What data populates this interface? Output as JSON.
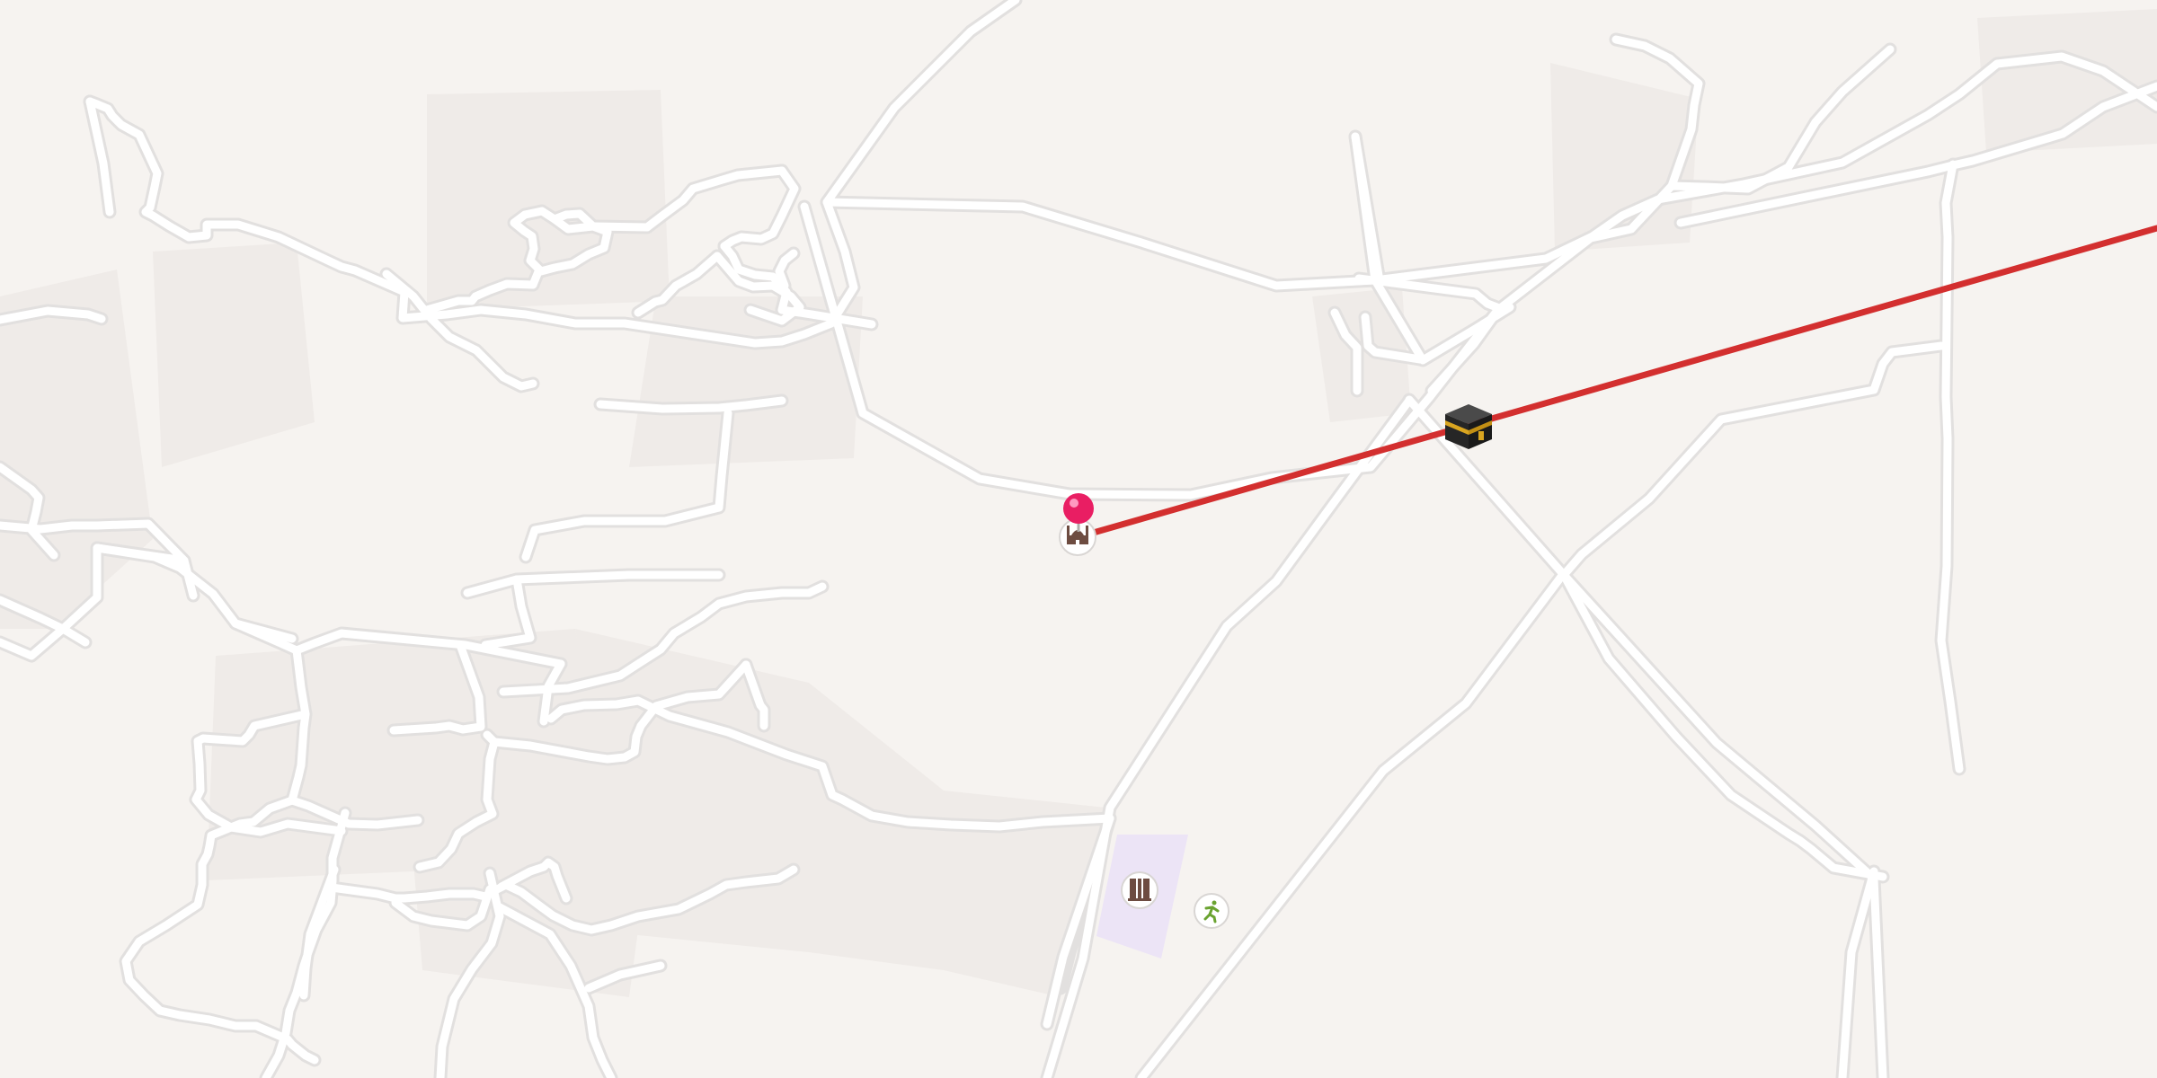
{
  "map": {
    "background_color": "#f6f3f0",
    "road_color": "#ffffff",
    "road_edge_color": "#e2e0df",
    "block_shade_color": "#ede9e7",
    "campus_color": "#ebe2f7",
    "bearing_line": {
      "name": "qibla-direction-line",
      "color": "#d32f2f"
    },
    "markers": [
      {
        "name": "location-pin-icon",
        "icon": "map-pin",
        "color": "#e91e63"
      },
      {
        "name": "mosque-icon",
        "icon": "mosque"
      },
      {
        "name": "kaaba-icon",
        "icon": "kaaba"
      },
      {
        "name": "school-icon",
        "icon": "school"
      },
      {
        "name": "sports-icon",
        "icon": "running-person",
        "color": "#6aa330"
      }
    ]
  }
}
